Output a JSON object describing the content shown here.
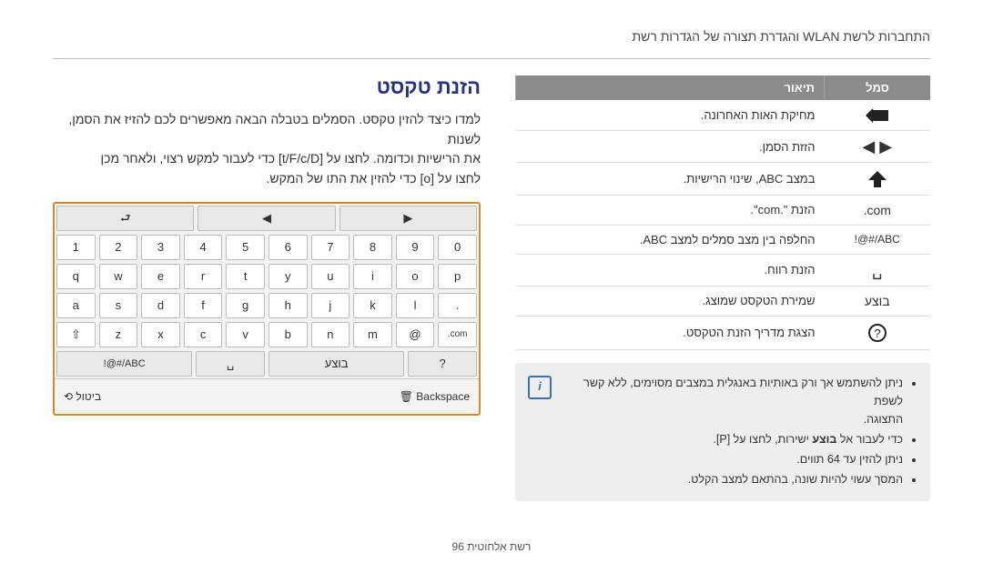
{
  "header": "התחברות לרשת WLAN והגדרת תצורה של הגדרות רשת",
  "title": "הזנת טקסט",
  "intro": {
    "l1a": "למדו כיצד להזין טקסט. הסמלים בטבלה הבאה מאפשרים לכם להזיז את הסמן, לשנות",
    "l1b": "את הרישיות וכדומה. לחצו על ",
    "l1c": " כדי לעבור למקש רצוי, ולאחר מכן",
    "l2a": "לחצו על ",
    "l2b": " כדי להזין את התו של המקש."
  },
  "brackets": {
    "outer": "[",
    "outerR": "]",
    "o": "o",
    "nav": "t/F/c/D"
  },
  "table": {
    "h1": "סמל",
    "h2": "תיאור",
    "rows": [
      {
        "sym": "back-arrow",
        "desc": "מחיקת האות האחרונה."
      },
      {
        "sym": "lr-arrows",
        "desc": "הזזת הסמן."
      },
      {
        "sym": "up-arrow",
        "desc": "במצב ABC, שינוי הרישיות."
      },
      {
        "sym": "com",
        "desc": "הזנת \".com\"."
      },
      {
        "sym": "abcsym",
        "desc": "החלפה בין מצב סמלים למצב ABC."
      },
      {
        "sym": "space",
        "desc": "הזנת רווח."
      },
      {
        "sym": "done",
        "desc": "שמירת הטקסט שמוצג."
      },
      {
        "sym": "help",
        "desc": "הצגת מדריך הזנת הטקסט."
      }
    ]
  },
  "symtext": {
    "com": ".com",
    "abcsym": "!@#/ABC",
    "done": "בוצע"
  },
  "note": {
    "b1a": "ניתן להשתמש אך ורק באותיות באנגלית במצבים מסוימים, ללא קשר לשפת",
    "b1b": "התצוגה.",
    "b2a": "כדי לעבור אל ",
    "b2bold": "בוצע",
    "b2b": " ישירות, לחצו על [P].",
    "b3": "ניתן להזין עד 64 תווים.",
    "b4": "המסך עשוי להיות שונה, בהתאם למצב הקלט."
  },
  "keys": {
    "row1": [
      "1",
      "2",
      "3",
      "4",
      "5",
      "6",
      "7",
      "8",
      "9",
      "0"
    ],
    "row2": [
      "q",
      "w",
      "e",
      "r",
      "t",
      "y",
      "u",
      "i",
      "o",
      "p"
    ],
    "row3": [
      "a",
      "s",
      "d",
      "f",
      "g",
      "h",
      "j",
      "k",
      "l",
      "."
    ],
    "row4": [
      "",
      "z",
      "x",
      "c",
      "v",
      "b",
      "n",
      "m",
      "@",
      ".com"
    ],
    "fn": {
      "abc": "!@#/ABC",
      "done": "בוצע"
    },
    "bottom": {
      "cancel": "ביטול",
      "bs": "Backspace"
    }
  },
  "footer": "רשת אלחוטית  96"
}
